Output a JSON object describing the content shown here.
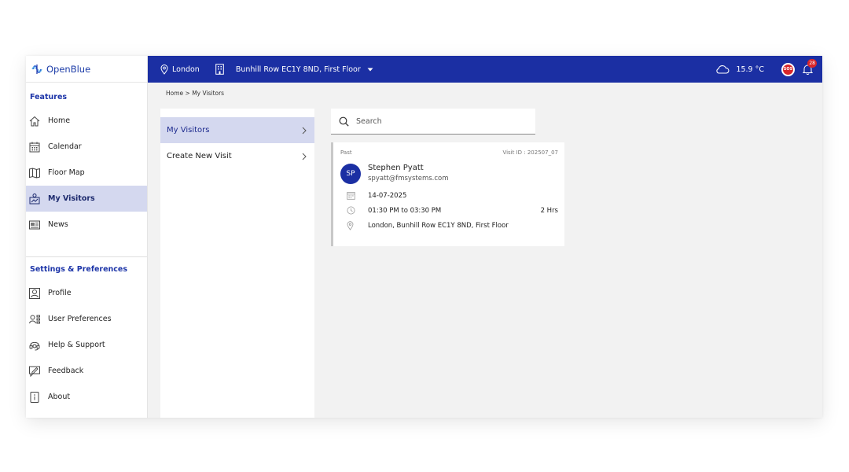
{
  "brand": {
    "name": "OpenBlue"
  },
  "sidebar": {
    "features_title": "Features",
    "features": [
      {
        "label": "Home",
        "icon": "home-icon"
      },
      {
        "label": "Calendar",
        "icon": "calendar-icon"
      },
      {
        "label": "Floor Map",
        "icon": "floor-map-icon"
      },
      {
        "label": "My Visitors",
        "icon": "visitors-icon",
        "active": true
      },
      {
        "label": "News",
        "icon": "news-icon"
      }
    ],
    "settings_title": "Settings & Preferences",
    "settings": [
      {
        "label": "Profile",
        "icon": "profile-icon"
      },
      {
        "label": "User Preferences",
        "icon": "user-preferences-icon"
      },
      {
        "label": "Help & Support",
        "icon": "headset-icon"
      },
      {
        "label": "Feedback",
        "icon": "feedback-icon"
      },
      {
        "label": "About",
        "icon": "about-icon"
      }
    ]
  },
  "topbar": {
    "location": "London",
    "building": "Bunhill Row EC1Y 8ND, First Floor",
    "temperature": "15.9 °C",
    "sos_label": "SOS",
    "notification_count": "28",
    "accent_color": "#1b2fa3",
    "alert_color": "#d8262a"
  },
  "breadcrumb": "Home > My Visitors",
  "submenu": {
    "items": [
      {
        "label": "My Visitors",
        "active": true
      },
      {
        "label": "Create New Visit"
      }
    ]
  },
  "search": {
    "placeholder": "Search"
  },
  "visit": {
    "status": "Past",
    "visit_id": "Visit ID : 202507_07",
    "initials": "SP",
    "name": "Stephen Pyatt",
    "email": "spyatt@fmsystems.com",
    "date": "14-07-2025",
    "time": "01:30 PM to 03:30 PM",
    "duration": "2 Hrs",
    "location": "London, Bunhill Row EC1Y 8ND, First Floor"
  }
}
